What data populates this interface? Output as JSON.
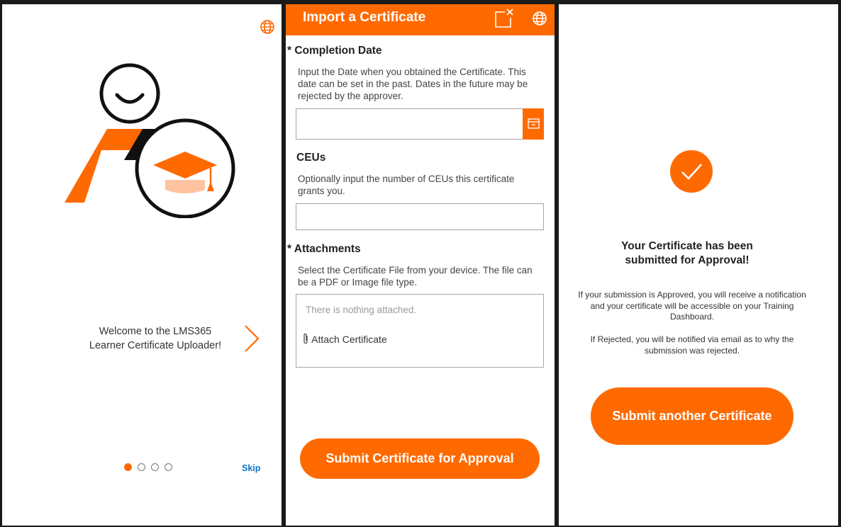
{
  "colors": {
    "accent": "#ff6a00",
    "link": "#0a74c9",
    "frame": "#1a1a1a"
  },
  "onboarding": {
    "welcome_line1": "Welcome to the LMS365",
    "welcome_line2": "Learner Certificate Uploader!",
    "skip_label": "Skip",
    "page_indicator": {
      "current": 1,
      "total": 4
    }
  },
  "import_form": {
    "title": "Import a Certificate",
    "completion_date": {
      "required_mark": "*",
      "label": "Completion Date",
      "help": "Input the Date when you obtained the Certificate. This date can be set in the past. Dates in the future may be rejected by the approver.",
      "value": ""
    },
    "ceus": {
      "label": "CEUs",
      "help": "Optionally input the number of CEUs this certificate grants you.",
      "value": ""
    },
    "attachments": {
      "required_mark": "*",
      "label": "Attachments",
      "help": "Select the Certificate File from your device. The file can be a PDF or Image file type.",
      "empty_text": "There is nothing attached.",
      "attach_label": "Attach Certificate"
    },
    "submit_label": "Submit Certificate for Approval"
  },
  "success": {
    "title_line1": "Your Certificate has been",
    "title_line2": "submitted for Approval!",
    "approved_text": "If your submission is Approved, you will receive a notification and your certificate will be accessible on your Training Dashboard.",
    "rejected_text": "If Rejected, you will be notified via email as to why the submission was rejected.",
    "submit_another_label": "Submit another Certificate"
  },
  "icons": [
    "globe-icon",
    "popout-close-icon",
    "calendar-icon",
    "paperclip-icon",
    "chevron-right-icon",
    "checkmark-icon",
    "graduation-cap-icon",
    "smiley-face-icon"
  ]
}
